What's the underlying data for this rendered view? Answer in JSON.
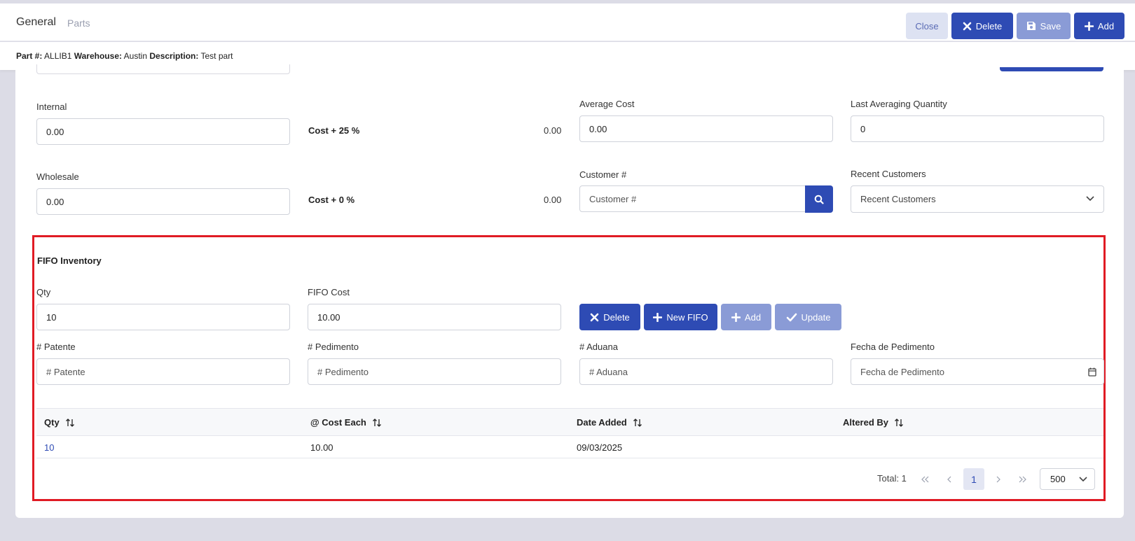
{
  "header": {
    "tabs": [
      "General",
      "Parts"
    ],
    "close_label": "Close",
    "delete_label": "Delete",
    "save_label": "Save",
    "add_label": "Add"
  },
  "info": {
    "part_label": "Part #:",
    "part_value": "ALLIB1",
    "warehouse_label": "Warehouse:",
    "warehouse_value": "Austin",
    "description_label": "Description:",
    "description_value": "Test part"
  },
  "pricing": {
    "internal_label": "Internal",
    "internal_value": "0.00",
    "internal_rule": "Cost + 25 %",
    "internal_computed": "0.00",
    "wholesale_label": "Wholesale",
    "wholesale_value": "0.00",
    "wholesale_rule": "Cost + 0 %",
    "wholesale_computed": "0.00",
    "average_cost_label": "Average Cost",
    "average_cost_value": "0.00",
    "last_avg_qty_label": "Last Averaging Quantity",
    "last_avg_qty_value": "0",
    "customer_label": "Customer #",
    "customer_placeholder": "Customer #",
    "recent_customers_label": "Recent Customers",
    "recent_customers_value": "Recent Customers"
  },
  "fifo": {
    "title": "FIFO Inventory",
    "qty_label": "Qty",
    "qty_value": "10",
    "cost_label": "FIFO Cost",
    "cost_value": "10.00",
    "delete_label": "Delete",
    "new_fifo_label": "New FIFO",
    "add_label": "Add",
    "update_label": "Update",
    "patente_label": "# Patente",
    "patente_placeholder": "# Patente",
    "pedimento_label": "# Pedimento",
    "pedimento_placeholder": "# Pedimento",
    "aduana_label": "# Aduana",
    "aduana_placeholder": "# Aduana",
    "fecha_label": "Fecha de Pedimento",
    "fecha_placeholder": "Fecha de Pedimento",
    "columns": [
      "Qty",
      "@ Cost Each",
      "Date Added",
      "Altered By"
    ],
    "rows": [
      {
        "qty": "10",
        "cost": "10.00",
        "date": "09/03/2025",
        "altered": ""
      }
    ],
    "total_label": "Total: 1",
    "current_page": "1",
    "page_size": "500"
  },
  "colors": {
    "primary": "#2e4bb4",
    "primary_disabled": "#8a9bd6",
    "highlight": "#e01b24"
  }
}
